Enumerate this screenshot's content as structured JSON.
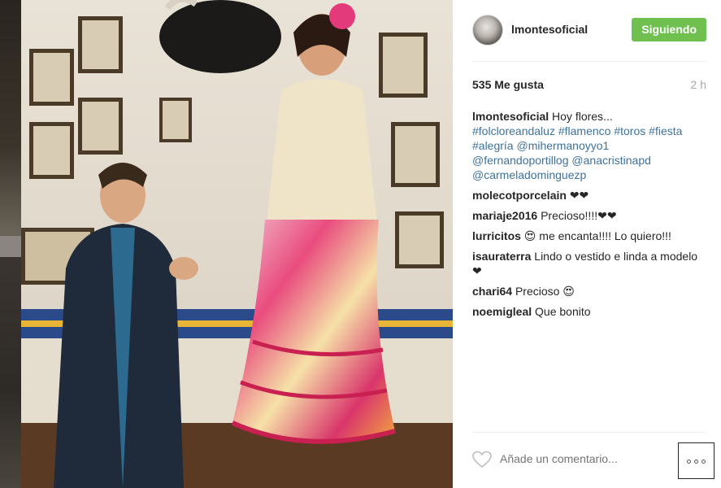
{
  "post": {
    "username": "lmontesoficial",
    "follow_label": "Siguiendo",
    "likes": "535 Me gusta",
    "time": "2 h"
  },
  "caption": {
    "author": "lmontesoficial",
    "text": "Hoy flores...",
    "tags": [
      "#folcloreandaluz",
      "#flamenco",
      "#toros",
      "#fiesta",
      "#alegría",
      "@mihermanoyyo1",
      "@fernandoportillog",
      "@anacristinapd",
      "@carmeladominguezp"
    ]
  },
  "comments": [
    {
      "author": "molecotporcelain",
      "text": "❤❤"
    },
    {
      "author": "mariaje2016",
      "text": "Precioso!!!!❤❤"
    },
    {
      "author": "lurricitos",
      "text": "😍 me encanta!!!! Lo quiero!!!"
    },
    {
      "author": "isauraterra",
      "text": "Lindo o vestido e linda a modelo❤"
    },
    {
      "author": "chari64",
      "text": "Precioso 😍"
    },
    {
      "author": "noemigleal",
      "text": "Que bonito"
    }
  ],
  "footer": {
    "comment_placeholder": "Añade un comentario...",
    "heart_icon": "heart-outline-icon",
    "more_icon": "ellipsis-icon"
  },
  "colors": {
    "follow_green": "#70c050",
    "link_blue": "#3f729b"
  }
}
